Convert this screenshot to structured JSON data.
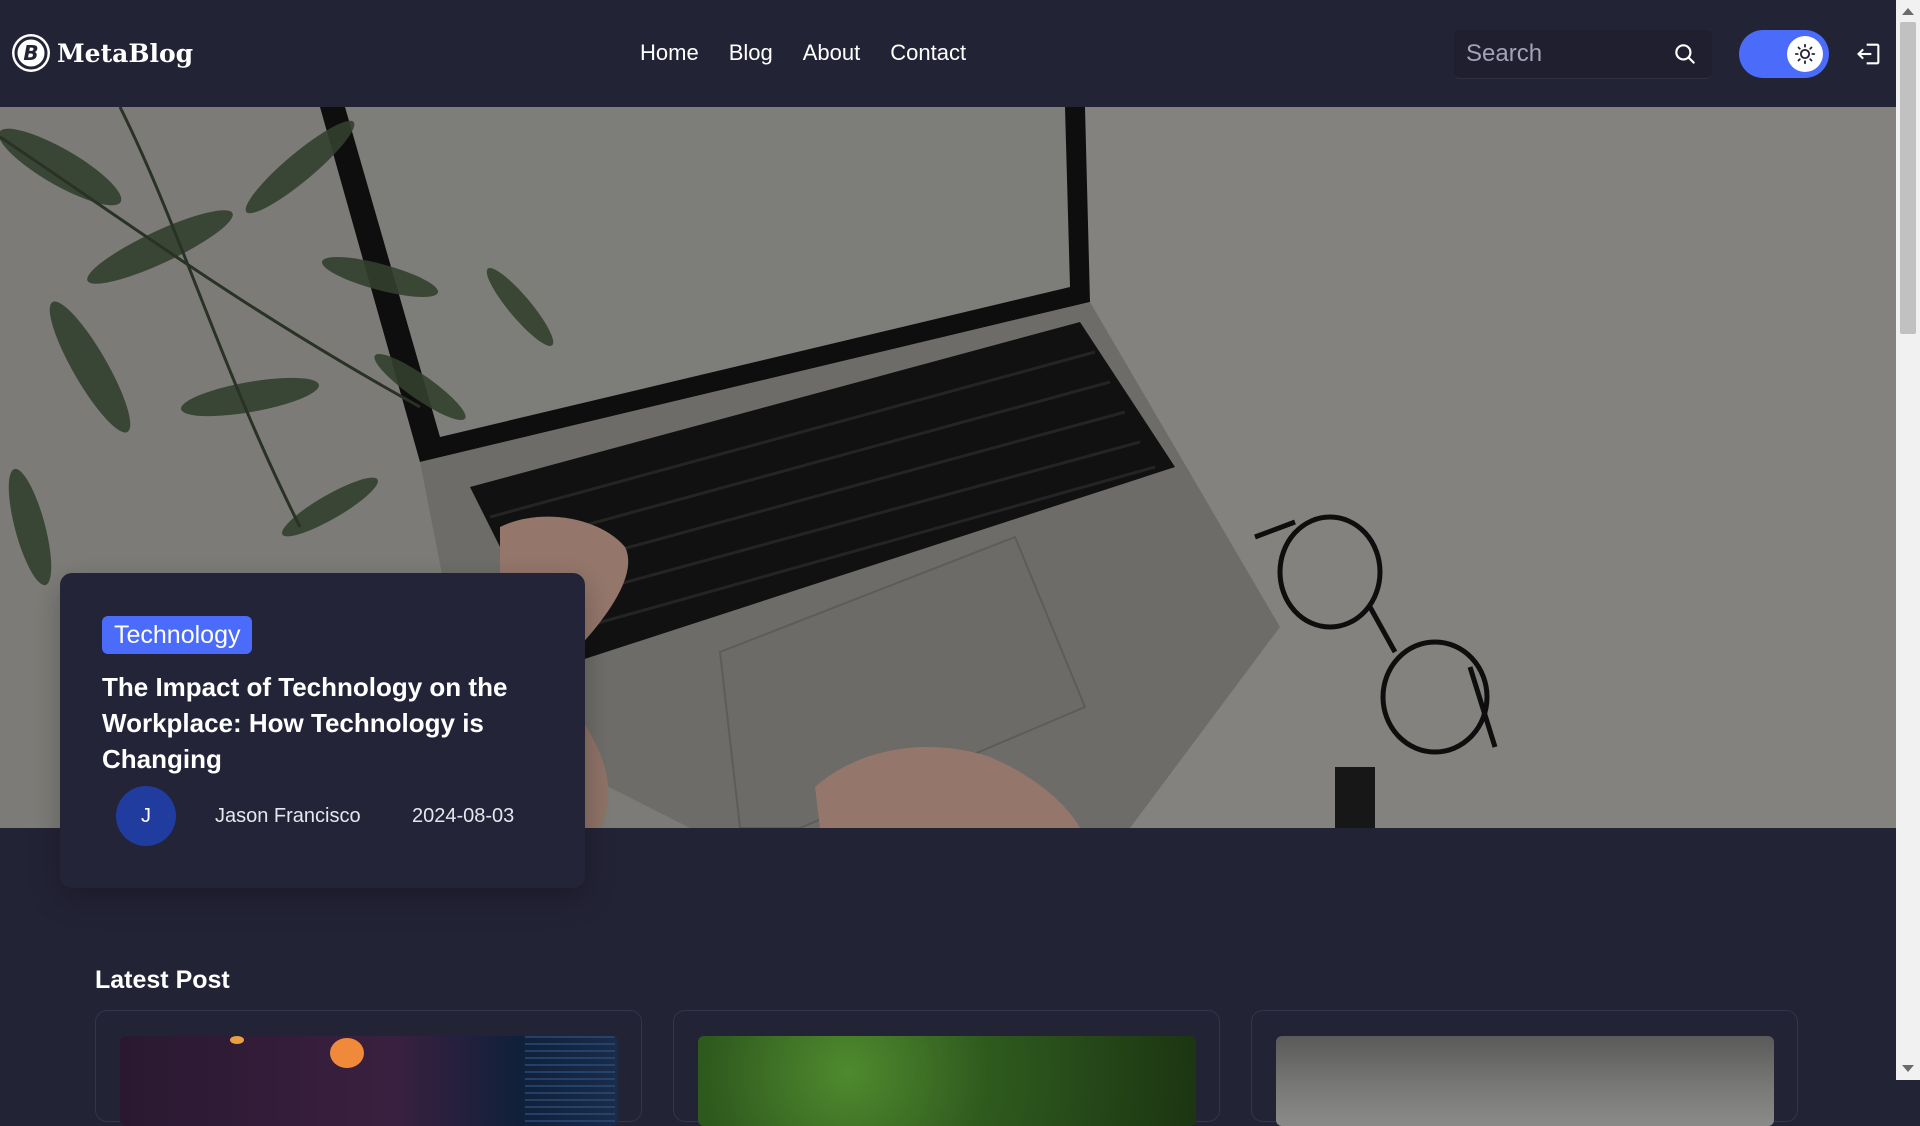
{
  "header": {
    "logo_text": "MetaBlog",
    "nav": [
      {
        "label": "Home"
      },
      {
        "label": "Blog"
      },
      {
        "label": "About"
      },
      {
        "label": "Contact"
      }
    ],
    "search_placeholder": "Search",
    "theme_toggle_icon": "sun-icon",
    "logout_icon": "logout-icon"
  },
  "hero": {
    "image_icon": "laptop-desk-photo",
    "category": "Technology",
    "title": "The Impact of Technology on the Workplace: How Technology is Changing",
    "author_initial": "J",
    "author_name": "Jason Francisco",
    "date": "2024-08-03"
  },
  "latest": {
    "heading": "Latest Post",
    "cards": [
      {
        "image_icon": "bokeh-code-photo"
      },
      {
        "image_icon": "green-leaves-photo"
      },
      {
        "image_icon": "grey-photo"
      }
    ]
  },
  "colors": {
    "background": "#232336",
    "accent": "#4b6bfb",
    "avatar": "#1f3c9e"
  }
}
